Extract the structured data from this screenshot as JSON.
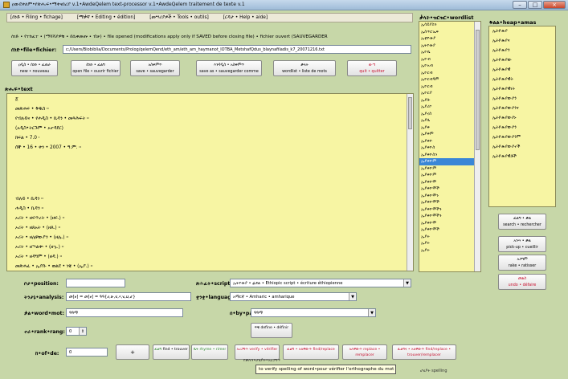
{
  "window": {
    "title": "ዐውደቀለም•የጽሑፍ•ማቀናበሪያ v.1•AwdeQelem text-processor v.1•AwdeQelem traitement de texte v.1",
    "minimize": "–",
    "maximize": "□",
    "close": "×"
  },
  "menu": [
    "[ሰነድ • Filing • fichage]",
    "[ማቃኛ • Editing • édition]",
    "[መሣሪያዎች • Tools • outils]",
    "[ርዳታ • Help • aide]"
  ],
  "file_status": "ሰነድ • የተከፈተ • (ማሻሻያዎቹ • በሲቀመጡ • ብቻ) • file opened (modifications apply only if SAVED before closing file) • fichier ouvert (SAUVEGARDER",
  "file_label": "ሰነድ•file•fichier:",
  "file_path": "c:/Users/Biobiblia/Documents/Prolog/qelemQend/eth_am/eth_am_haymanot_lOTBA_MetshafQdus_blaynafiladis_k7_20071216.txt",
  "toolbar": [
    {
      "line1": "ዐዲስ • ሰነድ • ፈጠራ",
      "line2": "new • nouveau",
      "red": false
    },
    {
      "line1": "ሰነድ • ፈልግ",
      "line2": "open file • ouvrir fichier",
      "red": false
    },
    {
      "line1": "አስቀምጥ",
      "line2": "save • sauvegarder",
      "red": false
    },
    {
      "line1": "እንዳዲስ • አስቀምጥ",
      "line2": "save as • sauvegarder comme",
      "red": false
    },
    {
      "line1": "ቃላት",
      "line2": "wordlist • liste de mots",
      "red": false
    },
    {
      "line1": "ውጣ",
      "line2": "quit • quitter",
      "red": true
    }
  ],
  "text_label": "ጽሑፍ•text",
  "text_lines_top": [
    "፩",
    "መጽሐፍ • ቅዱስ ።",
    "የብሉይና • የሐዲስ • ኪዳን • መጻሕፍት ።",
    "(አዲስ•ትርጉም • አተዳደር)",
    "ክፍል • 7.0 ፡",
    "ሰኞ • 16 • ቀን • 2007 • ዓ.ም. ።"
  ],
  "text_lines_bottom": [
    "ብሉይ • ኪዳን ።",
    "ሐዲስ • ኪዳን ።",
    "ኦሪት • ዘፍጥረት • (ዘፍ.) ።",
    "ኦሪት • ዘጸአት • (ዘጸ.) ።",
    "ኦሪት • ዘሌዋውያን • (ዘሌ.) ።",
    "ኦሪት • ዘኍልቍ • (ዘኁ.) ።",
    "ኦሪት • ዘዳግም • (ዘዳ.) ።",
    "መጽሐፈ • ኢያሱ • ወልደ • ነዌ • (ኢያ.) ።"
  ],
  "wordlist_label": "ቃላት•ዝርዝር•wordlist",
  "wordlist": [
    "ኢሳይያስን",
    "ኢስጥሮኤፍ",
    "ኢቲዮጵያ",
    "ኢትዮጵያ",
    "ኢዮቤ",
    "ኢዮብ",
    "ኢዮአብ",
    "ኢዮርብ",
    "ኢዮርብዓም",
    "ኢዮርብ",
    "ኢዮርያ",
    "ኢያሱ",
    "ኢያሪኮ",
    "ኢያኖስ",
    "ኢያሴ",
    "ኢያቅ",
    "ኢያቅም",
    "ኢያቅዮ",
    "ኢያቅዮስ",
    "ኢያቅዮስን",
    "ኢያቅዮም",
    "ኢያቅዮም",
    "ኢያቅዮም",
    "ኢያቅዮሞ",
    "ኢያቅዮሞች",
    "ኢያቅዮሞን",
    "ኢያቅዮሞች",
    "ኢያቅዮሞችን",
    "ኢያቅዮሞችን",
    "ኢያቅዮሞ",
    "ኢያቅዮሞች",
    "ኢያት",
    "ኢያት",
    "ኢያት"
  ],
  "wordlist_selected": 20,
  "heap_label": "ቅልል•heap•amas",
  "heap": [
    "ኢትዮጵያ",
    "ኢትዮጵያና",
    "ኢትዮጵያን",
    "ኢትዮጵያው",
    "ኢትዮጵያዊ",
    "ኢትዮጵያዊት",
    "ኢትዮጵያዊነት",
    "ኢትዮጵያውያን",
    "ኢትዮጵያውያንና",
    "ኢትዮጵያውያኑ",
    "ኢትዮጵያውያን",
    "ኢትዮጵያውያንም",
    "ኢትዮጵያውያኖች",
    "ኢትዮጵያዊቶች"
  ],
  "right_buttons": [
    {
      "line1": "ፈልግ • ቃል",
      "line2": "search • rechercher",
      "red": false
    },
    {
      "line1": "አንሣ • ቃል",
      "line2": "pick-up • cueillir",
      "red": false
    },
    {
      "line1": "አጋግም",
      "line2": "rake • ratisser",
      "red": false
    },
    {
      "line1": "መልስ",
      "line2": "undo • défaire",
      "red": true
    }
  ],
  "bottom": {
    "position_label": "ቦታ•position:",
    "position_value": "",
    "script_label": "ጽሕፈት•script:",
    "script_value": "ኢትዮጵያ • ፊደል • Ethiopic script • écriture éthiopienne",
    "analysis_label": "ትንታኔ•analysis:",
    "analysis_value": "መ[ፀ] = መ[ፀ] = ዓዓ{ሀ,ሁ,ሂ,ሃ,ሄ,ህ,ሆ}",
    "language_label": "ቋንቋ•language:",
    "language_value": "አማርኛ • Amharic • amharique",
    "word_label": "ቃል•word•mot:",
    "word_value": "ዓዓማ",
    "bypar_label": "በ•by•par:",
    "bypar_value": "ዓዓማ",
    "define_line1": "ፍቺ",
    "define_line2": "define • définir",
    "rank_label": "ተራ•rank•rang:",
    "rank_value": "0",
    "hold_label": "ከ•of•de:",
    "hold_value": "0",
    "plus_label": "+",
    "find_line1": "ፈልግ",
    "find_line2": "find • trouver",
    "rhyme_line1": "ቤት",
    "rhyme_line2": "rhyme • rimer",
    "verify_line1": "አረጋግጥ",
    "verify_line2": "verify • vérifier",
    "findreplace_line1": "ፈልግ • አለዋውጥ",
    "findreplace_line2": "find/replace",
    "replace_line1": "አለዋውጥ",
    "replace_line2": "replace • remplacer",
    "findreplace2_line1": "ፈልግና • አለዋውጥ",
    "findreplace2_line2": "find/replace • trouver/remplacer"
  },
  "tooltip": {
    "top_text": "የቃሉን•ሆሄያት•አረጋግጥ",
    "text": "to verify spelling of word•pour vérifier l'orthographe du mot",
    "side_text": "ሆሄያት spelling"
  }
}
